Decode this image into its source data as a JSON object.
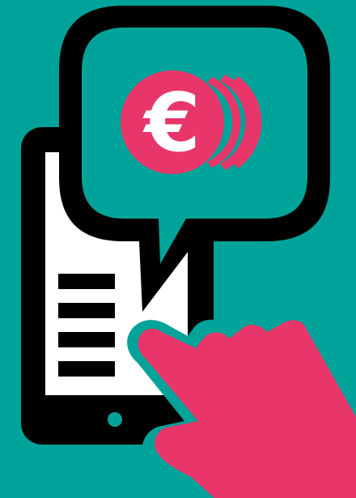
{
  "colors": {
    "background": "#00a399",
    "outline": "#000000",
    "screen": "#ffffff",
    "accent": "#e8366a",
    "coin_symbol": "#ffffff"
  },
  "icons": {
    "device": "smartphone-icon",
    "bubble": "speech-bubble-icon",
    "coin": "euro-coin-icon",
    "menu": "text-lines-icon",
    "pointer": "pointing-hand-icon"
  },
  "coin": {
    "symbol": "€"
  }
}
